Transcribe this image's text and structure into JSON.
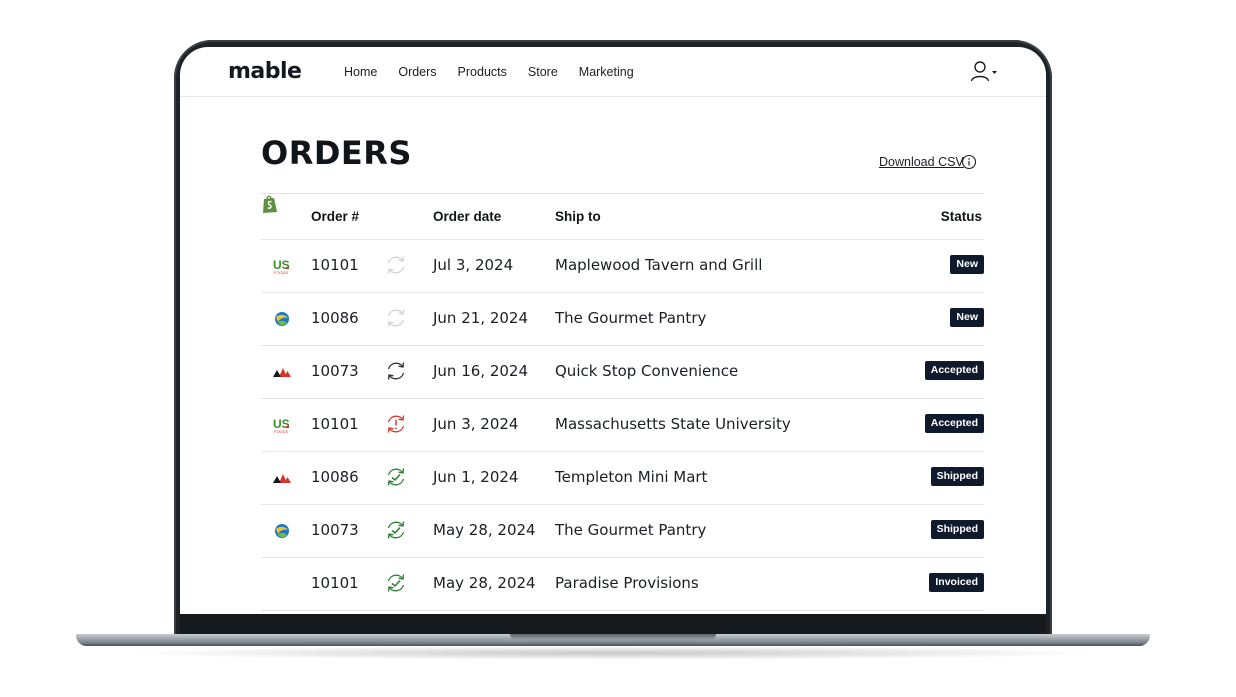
{
  "app": {
    "brand": "mable",
    "nav": [
      "Home",
      "Orders",
      "Products",
      "Store",
      "Marketing"
    ]
  },
  "page": {
    "title": "ORDERS",
    "download_label": "Download CSV"
  },
  "table": {
    "headers": {
      "order": "Order #",
      "channel": "shopify-icon",
      "date": "Order date",
      "ship_to": "Ship to",
      "status": "Status"
    },
    "rows": [
      {
        "logo": "us-foods-logo",
        "order": "10101",
        "sync": "sync-pending",
        "date": "Jul 3, 2024",
        "ship_to": "Maplewood Tavern and Grill",
        "status": "New"
      },
      {
        "logo": "globe-logo",
        "order": "10086",
        "sync": "sync-pending",
        "date": "Jun 21, 2024",
        "ship_to": "The Gourmet Pantry",
        "status": "New"
      },
      {
        "logo": "mountain-logo",
        "order": "10073",
        "sync": "sync-neutral",
        "date": "Jun 16, 2024",
        "ship_to": "Quick Stop Convenience",
        "status": "Accepted"
      },
      {
        "logo": "us-foods-logo",
        "order": "10101",
        "sync": "sync-error",
        "date": "Jun 3, 2024",
        "ship_to": "Massachusetts State University",
        "status": "Accepted"
      },
      {
        "logo": "mountain-logo",
        "order": "10086",
        "sync": "sync-success",
        "date": "Jun 1, 2024",
        "ship_to": "Templeton Mini Mart",
        "status": "Shipped"
      },
      {
        "logo": "globe-logo",
        "order": "10073",
        "sync": "sync-success",
        "date": "May 28, 2024",
        "ship_to": "The Gourmet Pantry",
        "status": "Shipped"
      },
      {
        "logo": "",
        "order": "10101",
        "sync": "sync-success",
        "date": "May 28, 2024",
        "ship_to": "Paradise Provisions",
        "status": "Invoiced"
      }
    ]
  },
  "colors": {
    "badge_bg": "#0f1b2d",
    "sync_success": "#2e7d32",
    "sync_error": "#d9342b",
    "sync_pending": "#d0d3d7",
    "sync_neutral": "#2b3036",
    "shopify": "#5e8e3e"
  }
}
